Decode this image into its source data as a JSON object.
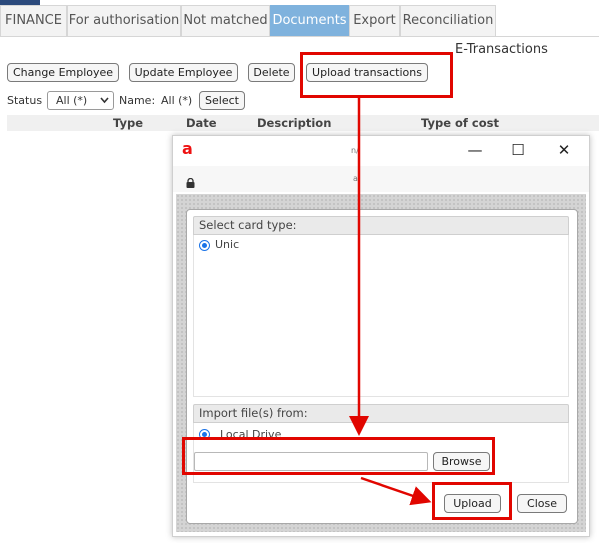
{
  "tabs": [
    {
      "label": "FINANCE"
    },
    {
      "label": "For authorisation"
    },
    {
      "label": "Not matched"
    },
    {
      "label": "Documents",
      "active": true
    },
    {
      "label": "Export"
    },
    {
      "label": "Reconciliation"
    }
  ],
  "page_title": "E-Transactions",
  "toolbar": {
    "change_employee": "Change Employee",
    "update_employee": "Update Employee",
    "delete": "Delete",
    "upload_transactions": "Upload transactions"
  },
  "filters": {
    "status_label": "Status",
    "status_value": "All (*)",
    "name_label": "Name:",
    "name_value": "All (*)",
    "select_button": "Select"
  },
  "table": {
    "columns": [
      "Type",
      "Date",
      "Description",
      "Type of cost"
    ]
  },
  "dialog": {
    "logo": "a",
    "window_title": "n/",
    "address": "a:",
    "minimize_glyph": "—",
    "maximize_glyph": "☐",
    "close_glyph": "✕",
    "card_section": "Select card type:",
    "card_option": "Unic",
    "import_section": "Import file(s) from:",
    "import_option": "Local Drive",
    "browse": "Browse",
    "upload": "Upload",
    "close": "Close"
  },
  "colors": {
    "active_tab": "#7fb2dd",
    "annotation_red": "#e10600",
    "radio_blue": "#1a73e8"
  }
}
